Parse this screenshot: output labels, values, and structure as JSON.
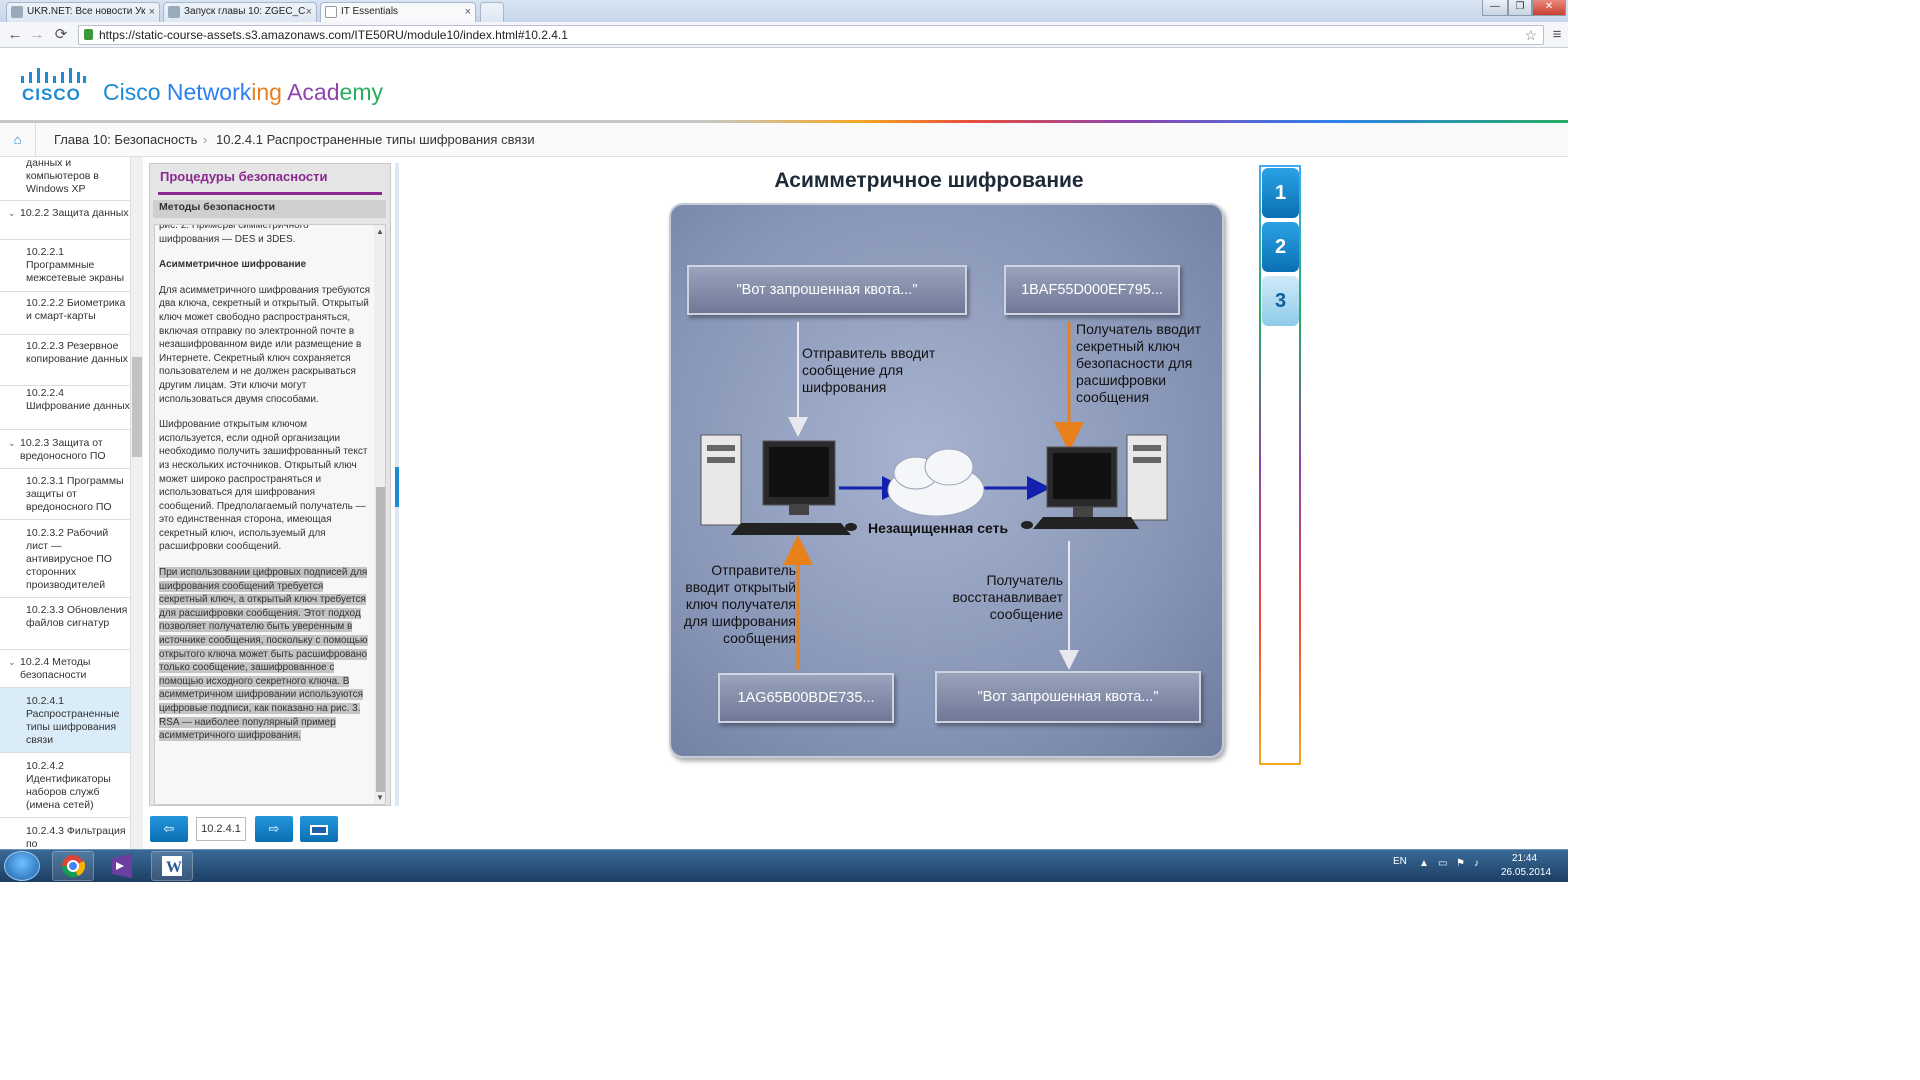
{
  "browser": {
    "tabs": [
      {
        "label": "UKR.NET: Все новости Ук"
      },
      {
        "label": "Запуск главы 10: ZGEC_С"
      },
      {
        "label": "IT Essentials"
      }
    ],
    "close_glyph": "×",
    "url": "https://static-course-assets.s3.amazonaws.com/ITE50RU/module10/index.html#10.2.4.1",
    "window_controls": [
      "—",
      "❐",
      "✕"
    ],
    "nav_icons": {
      "back": "←",
      "forward": "→",
      "reload": "⟳",
      "menu": "≡",
      "star": "☆"
    }
  },
  "header": {
    "logo_word": "CISCO",
    "academy_words": [
      {
        "text": "Cisco ",
        "color": "#1b8bd6"
      },
      {
        "text": "Network",
        "color": "#2f80ed"
      },
      {
        "text": "ing ",
        "color": "#e84c3d"
      },
      {
        "text": "Acad",
        "color": "#8e44ad"
      },
      {
        "text": "emy",
        "color": "#27ae60"
      }
    ]
  },
  "breadcrumb": {
    "home_icon": "home-icon",
    "home_glyph": "⌂",
    "chapter": "Глава 10: Безопасность",
    "separator": "›",
    "current": "10.2.4.1 Распространенные типы шифрования связи"
  },
  "sidebar": {
    "items": [
      {
        "label": "данных и компьютеров в Windows XP",
        "kind": "sub"
      },
      {
        "label": "10.2.2 Защита данных",
        "kind": "sec"
      },
      {
        "label": "10.2.2.1 Программные межсетевые экраны",
        "kind": "sub"
      },
      {
        "label": "10.2.2.2 Биометрика и смарт-карты",
        "kind": "sub"
      },
      {
        "label": "10.2.2.3 Резервное копирование данных",
        "kind": "sub"
      },
      {
        "label": "10.2.2.4 Шифрование данных",
        "kind": "sub"
      },
      {
        "label": "10.2.3 Защита от вредоносного ПО",
        "kind": "sec"
      },
      {
        "label": "10.2.3.1 Программы защиты от вредоносного ПО",
        "kind": "sub"
      },
      {
        "label": "10.2.3.2 Рабочий лист — антивирусное ПО сторонних производителей",
        "kind": "sub"
      },
      {
        "label": "10.2.3.3 Обновления файлов сигнатур",
        "kind": "sub"
      },
      {
        "label": "10.2.4 Методы безопасности",
        "kind": "sec"
      },
      {
        "label": "10.2.4.1 Распространенные типы шифрования связи",
        "kind": "sub",
        "current": true
      },
      {
        "label": "10.2.4.2 Идентификаторы наборов служб (имена сетей)",
        "kind": "sub"
      },
      {
        "label": "10.2.4.3 Фильтрация по",
        "kind": "sub"
      }
    ],
    "chevron": "⌄"
  },
  "panel": {
    "title": "Процедуры безопасности",
    "subtitle": "Методы безопасности",
    "top_fragment": "рис. 2. Примеры симметричного шифрования — DES и 3DES.",
    "heading": "Асимметричное шифрование",
    "paragraphs": [
      "Для асимметричного шифрования требуются два ключа, секретный и открытый. Открытый ключ может свободно распространяться, включая отправку по электронной почте в незашифрованном виде или размещение в Интернете. Секретный ключ сохраняется пользователем и не должен раскрываться другим лицам. Эти ключи могут использоваться двумя способами.",
      "Шифрование открытым ключом используется, если одной организации необходимо получить зашифрованный текст из нескольких источников. Открытый ключ может широко распространяться и использоваться для шифрования сообщений. Предполагаемый получатель — это единственная сторона, имеющая секретный ключ, используемый для расшифровки сообщений.",
      "При использовании цифровых подписей для шифрования сообщений требуется секретный ключ, а открытый ключ требуется для расшифровки сообщения. Этот подход позволяет получателю быть уверенным в источнике сообщения, поскольку с помощью открытого ключа может быть расшифровано только сообщение, зашифрованное с помощью исходного секретного ключа. В асимметричном шифровании используются цифровые подписи, как показано на рис. 3. RSA — наиболее популярный пример асимметричного шифрования."
    ],
    "scroll_up": "▲",
    "scroll_down": "▼"
  },
  "controls": {
    "prev_glyph": "⇦",
    "next_glyph": "⇨",
    "page_value": "10.2.4.1"
  },
  "figure": {
    "title": "Асимметричное шифрование",
    "plain_top": "\"Вот запрошенная квота...\"",
    "cipher_top": "1BAF55D000EF795...",
    "sender_encrypts": "Отправитель вводит сообщение для шифрования",
    "receiver_key": "Получатель вводит секретный ключ безопасности для расшифровки сообщения",
    "network": "Незащищенная сеть",
    "sender_pubkey": "Отправитель вводит открытый ключ получателя для шифрования сообщения",
    "receiver_restores": "Получатель восстанавливает сообщение",
    "cipher_bottom": "1AG65B00BDE735...",
    "plain_bottom": "\"Вот запрошенная квота...\""
  },
  "steps": [
    {
      "label": "1",
      "color": "#0a78c2"
    },
    {
      "label": "2",
      "color": "#0a78c2"
    },
    {
      "label": "3",
      "color": "#8fcbea"
    }
  ],
  "taskbar": {
    "lang": "EN",
    "time": "21:44",
    "date": "26.05.2014"
  }
}
